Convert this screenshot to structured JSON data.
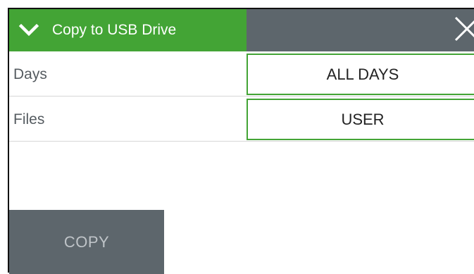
{
  "header": {
    "title": "Copy to USB Drive",
    "expand_icon": "chevron-down-icon",
    "close_icon": "close-icon"
  },
  "settings": [
    {
      "label": "Days",
      "value": "ALL DAYS"
    },
    {
      "label": "Files",
      "value": "USER"
    }
  ],
  "actions": {
    "copy_label": "COPY"
  },
  "colors": {
    "accent": "#43a435",
    "dark": "#5d666c",
    "button_text": "#bfc4c8"
  }
}
